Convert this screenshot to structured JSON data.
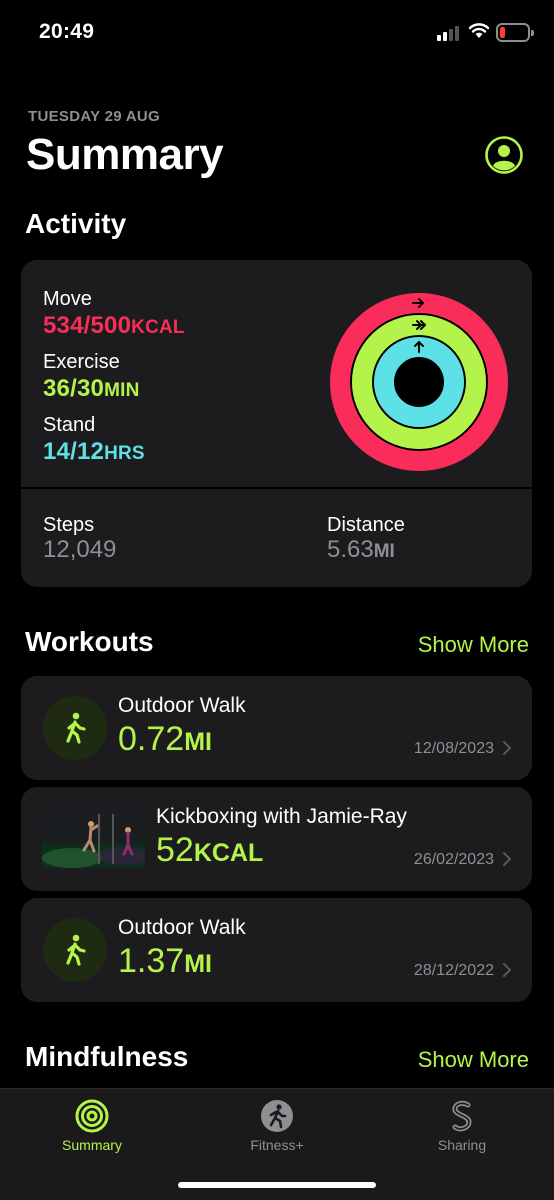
{
  "status_bar": {
    "time": "20:49"
  },
  "header": {
    "date": "TUESDAY 29 AUG",
    "title": "Summary"
  },
  "activity": {
    "section_title": "Activity",
    "move": {
      "label": "Move",
      "value": "534/500",
      "unit": "KCAL",
      "progress": 1.068
    },
    "exercise": {
      "label": "Exercise",
      "value": "36/30",
      "unit": "MIN",
      "progress": 1.2
    },
    "stand": {
      "label": "Stand",
      "value": "14/12",
      "unit": "HRS",
      "progress": 1.167
    },
    "steps": {
      "label": "Steps",
      "value": "12,049"
    },
    "distance": {
      "label": "Distance",
      "value": "5.63",
      "unit": "MI"
    }
  },
  "workouts": {
    "section_title": "Workouts",
    "show_more": "Show More",
    "items": [
      {
        "title": "Outdoor Walk",
        "value": "0.72",
        "unit": "MI",
        "date": "12/08/2023"
      },
      {
        "title": "Kickboxing with Jamie-Ray",
        "value": "52",
        "unit": "KCAL",
        "date": "26/02/2023"
      },
      {
        "title": "Outdoor Walk",
        "value": "1.37",
        "unit": "MI",
        "date": "28/12/2022"
      }
    ]
  },
  "mindfulness": {
    "section_title": "Mindfulness",
    "show_more": "Show More"
  },
  "tab_bar": {
    "tabs": [
      {
        "label": "Summary",
        "icon": "activity-rings-icon",
        "active": true
      },
      {
        "label": "Fitness+",
        "icon": "fitness-plus-icon",
        "active": false
      },
      {
        "label": "Sharing",
        "icon": "sharing-icon",
        "active": false
      }
    ]
  },
  "colors": {
    "move": "#fa2d5a",
    "exercise": "#b4f34a",
    "stand": "#5de0e6",
    "accent": "#b4f34a",
    "card": "#1c1c1e"
  }
}
